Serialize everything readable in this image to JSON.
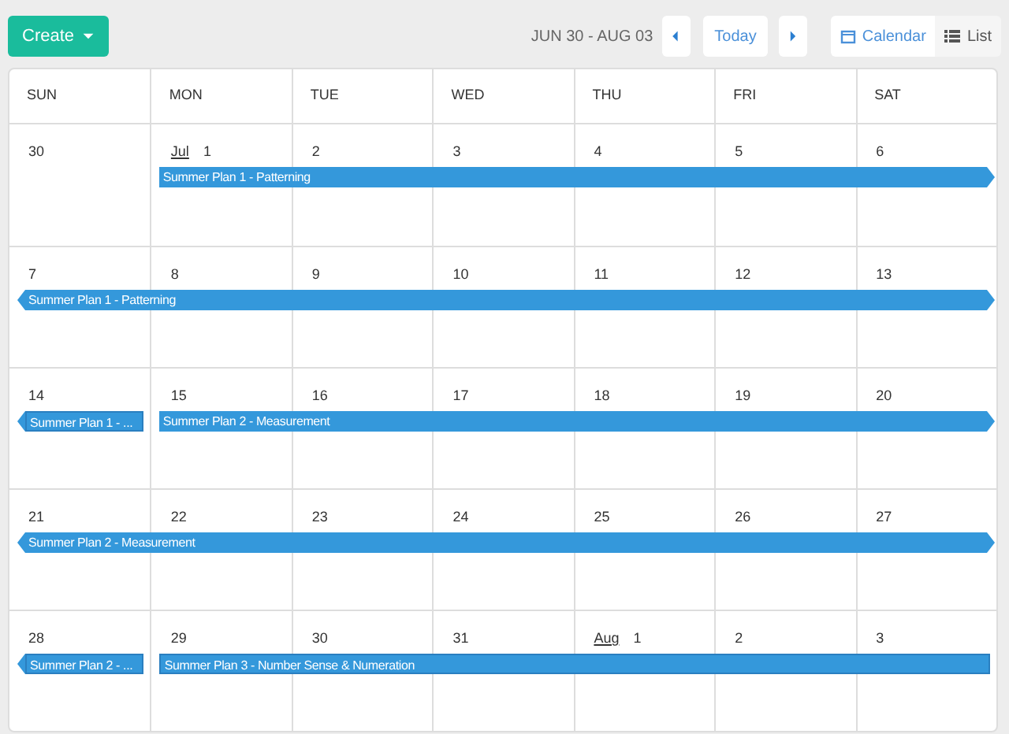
{
  "toolbar": {
    "create_label": "Create",
    "date_range": "JUN 30 - AUG 03",
    "today_label": "Today",
    "views": [
      {
        "label": "Calendar",
        "kind": "calendar",
        "selected": true
      },
      {
        "label": "List",
        "kind": "list",
        "selected": false
      }
    ]
  },
  "weekdays": [
    "SUN",
    "MON",
    "TUE",
    "WED",
    "THU",
    "FRI",
    "SAT"
  ],
  "weeks": [
    {
      "days": [
        {
          "day": "30"
        },
        {
          "month": "Jul",
          "day": "1"
        },
        {
          "day": "2"
        },
        {
          "day": "3"
        },
        {
          "day": "4"
        },
        {
          "day": "5"
        },
        {
          "day": "6"
        }
      ],
      "events": [
        {
          "title": "Summer Plan 1 - Patterning",
          "on_first_day": false,
          "on_later_days": true,
          "continues_before": false,
          "continues_after": true
        }
      ]
    },
    {
      "days": [
        {
          "day": "7"
        },
        {
          "day": "8"
        },
        {
          "day": "9"
        },
        {
          "day": "10"
        },
        {
          "day": "11"
        },
        {
          "day": "12"
        },
        {
          "day": "13"
        }
      ],
      "events": [
        {
          "title": "Summer Plan 1 - Patterning",
          "on_first_day": true,
          "on_later_days": true,
          "continues_before": true,
          "continues_after": true
        }
      ]
    },
    {
      "days": [
        {
          "day": "14"
        },
        {
          "day": "15"
        },
        {
          "day": "16"
        },
        {
          "day": "17"
        },
        {
          "day": "18"
        },
        {
          "day": "19"
        },
        {
          "day": "20"
        }
      ],
      "events": [
        {
          "title": "Summer Plan 1 - ...",
          "on_first_day": true,
          "on_later_days": false,
          "continues_before": true,
          "continues_after": false
        },
        {
          "title": "Summer Plan 2 - Measurement",
          "on_first_day": false,
          "on_later_days": true,
          "continues_before": false,
          "continues_after": true
        }
      ]
    },
    {
      "days": [
        {
          "day": "21"
        },
        {
          "day": "22"
        },
        {
          "day": "23"
        },
        {
          "day": "24"
        },
        {
          "day": "25"
        },
        {
          "day": "26"
        },
        {
          "day": "27"
        }
      ],
      "events": [
        {
          "title": "Summer Plan 2 - Measurement",
          "on_first_day": true,
          "on_later_days": true,
          "continues_before": true,
          "continues_after": true
        }
      ]
    },
    {
      "days": [
        {
          "day": "28"
        },
        {
          "day": "29"
        },
        {
          "day": "30"
        },
        {
          "day": "31"
        },
        {
          "month": "Aug",
          "day": "1"
        },
        {
          "day": "2"
        },
        {
          "day": "3"
        }
      ],
      "events": [
        {
          "title": "Summer Plan 2 - ...",
          "on_first_day": true,
          "on_later_days": false,
          "continues_before": true,
          "continues_after": false
        },
        {
          "title": "Summer Plan 3 - Number Sense & Numeration",
          "on_first_day": false,
          "on_later_days": true,
          "continues_before": false,
          "continues_after": false
        }
      ]
    }
  ]
}
